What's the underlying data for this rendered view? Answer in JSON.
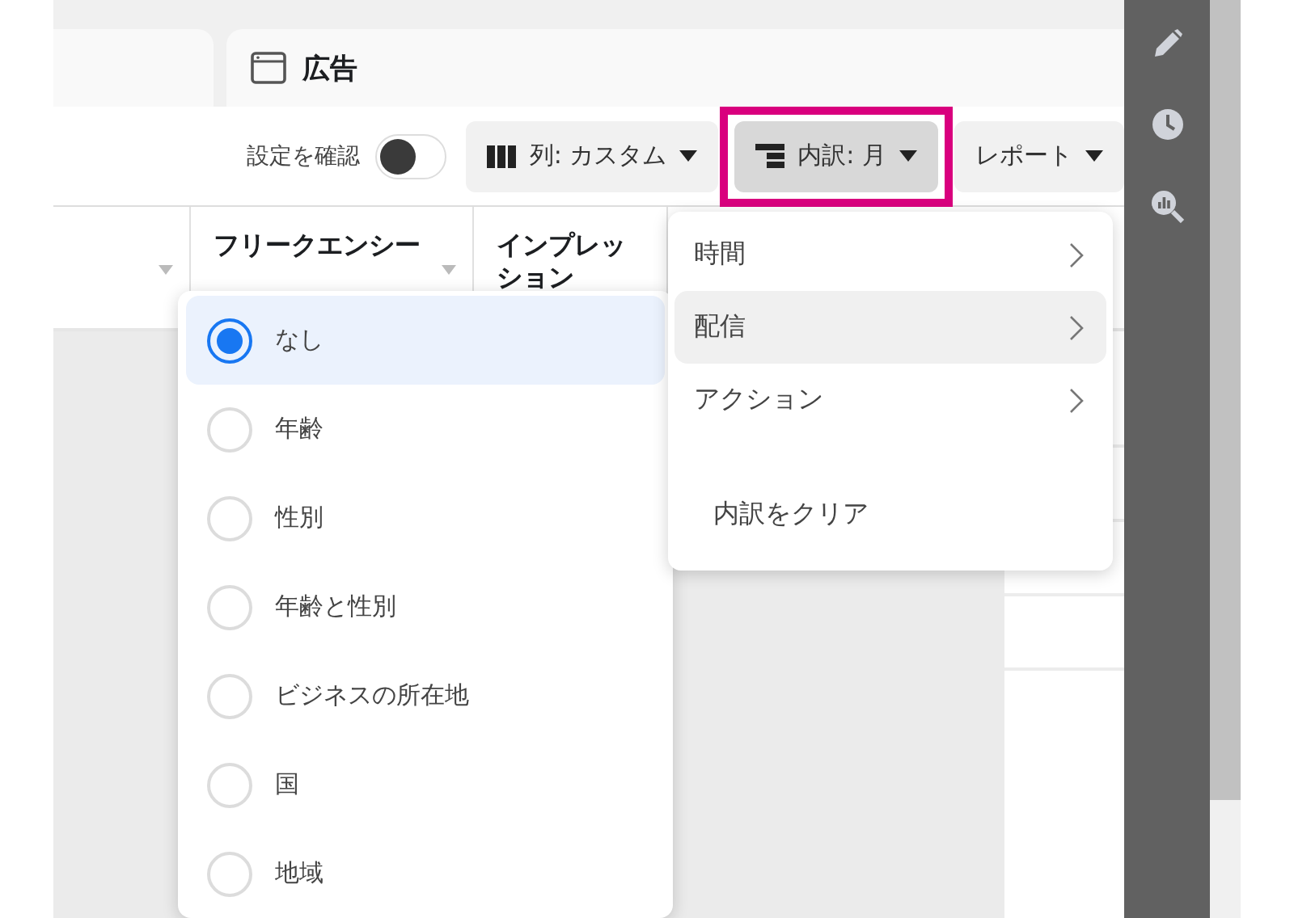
{
  "header_panel": {
    "title": "広告"
  },
  "toolbar": {
    "review_toggle": {
      "label": "設定を確認",
      "on": false
    },
    "buttons": [
      {
        "kind": "columns",
        "label": "列: カスタム",
        "selected": false,
        "highlighted": false
      },
      {
        "kind": "breakdown",
        "label": "内訳: 月",
        "selected": true,
        "highlighted": true
      },
      {
        "kind": "report",
        "label": "レポート",
        "selected": false,
        "highlighted": false
      }
    ]
  },
  "table": {
    "columns": [
      {
        "kind": "blank"
      },
      {
        "kind": "text",
        "label": "フリークエンシー"
      },
      {
        "kind": "text",
        "label": "インプレッション"
      }
    ]
  },
  "breakdown_menu": {
    "items": [
      {
        "kind": "submenu",
        "label": "時間",
        "selected": false
      },
      {
        "kind": "submenu",
        "label": "配信",
        "selected": true
      },
      {
        "kind": "submenu",
        "label": "アクション",
        "selected": false
      },
      {
        "kind": "action",
        "label": "内訳をクリア",
        "selected": false
      }
    ]
  },
  "delivery_options": [
    {
      "label": "なし",
      "selected": true
    },
    {
      "label": "年齢",
      "selected": false
    },
    {
      "label": "性別",
      "selected": false
    },
    {
      "label": "年齢と性別",
      "selected": false
    },
    {
      "label": "ビジネスの所在地",
      "selected": false
    },
    {
      "label": "国",
      "selected": false
    },
    {
      "label": "地域",
      "selected": false
    }
  ]
}
